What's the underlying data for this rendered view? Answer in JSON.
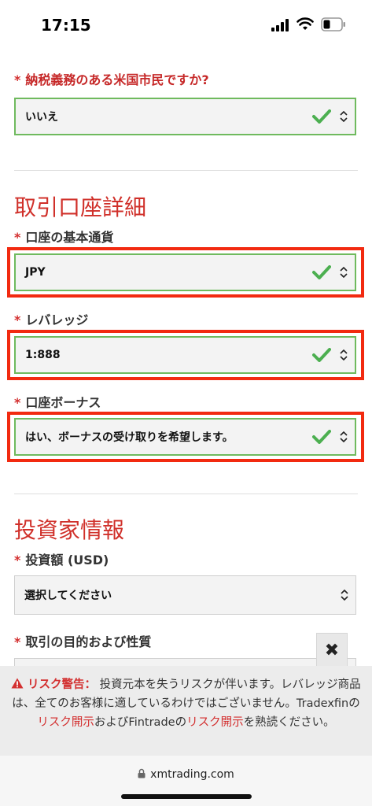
{
  "status": {
    "time": "17:15"
  },
  "tax_question": {
    "label": "納税義務のある米国市民ですか?",
    "value": "いいえ"
  },
  "account_details": {
    "title": "取引口座詳細",
    "currency": {
      "label": "口座の基本通貨",
      "value": "JPY"
    },
    "leverage": {
      "label": "レバレッジ",
      "value": "1:888"
    },
    "bonus": {
      "label": "口座ボーナス",
      "value": "はい、ボーナスの受け取りを希望します。"
    }
  },
  "investor_info": {
    "title": "投資家情報",
    "amount": {
      "label": "投資額 (USD)",
      "value": "選択してください"
    },
    "purpose": {
      "label": "取引の目的および性質"
    }
  },
  "required_mark": "*",
  "risk_warning": {
    "title": "リスク警告：",
    "text1": "投資元本を失うリスクが伴います。レバレッジ商品は、全てのお客様に適しているわけではございません。Tradexfinの",
    "link1": "リスク開示",
    "text2": "およびFintradeの",
    "link2": "リスク開示",
    "text3": "を熟読ください。"
  },
  "close_symbol": "✖",
  "browser": {
    "url": "xmtrading.com"
  },
  "colors": {
    "accent_red": "#d0302a",
    "valid_green": "#6fba5e",
    "highlight": "#f22a10"
  }
}
